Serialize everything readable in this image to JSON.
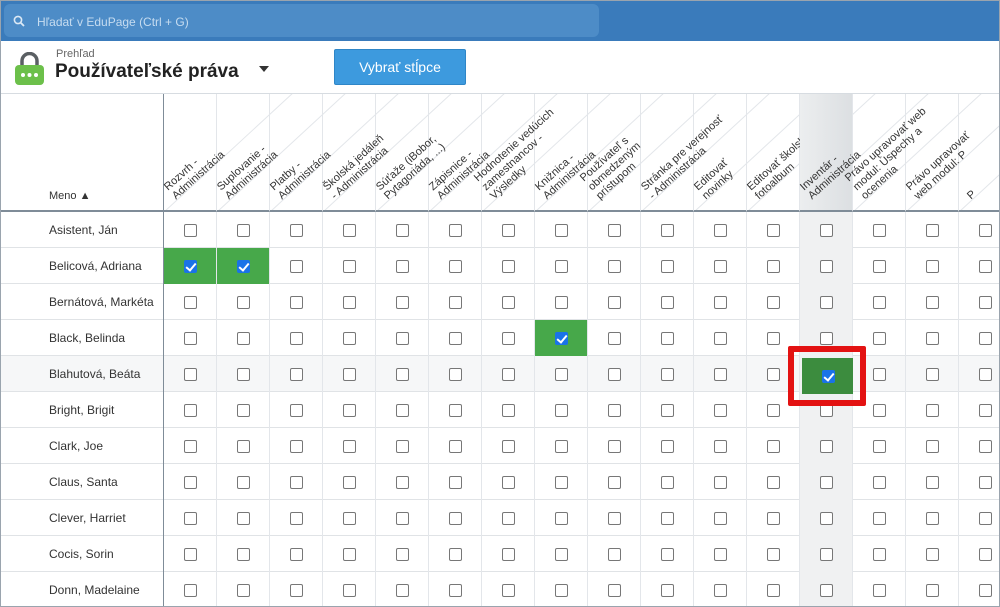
{
  "search": {
    "placeholder": "Hľadať v EduPage (Ctrl + G)"
  },
  "header": {
    "breadcrumb": "Prehľad",
    "title": "Používateľské práva",
    "select_columns_label": "Vybrať stĺpce"
  },
  "table": {
    "name_header": "Meno ▲",
    "columns": [
      "Rozvrh -\nAdministrácia",
      "Suplovanie -\nAdministrácia",
      "Platby -\nAdministrácia",
      "Školská jedáleň\n- Administrácia",
      "Súťaže (iBobor,\nPytagoriáda, ...)",
      "Zápisnice -\nAdministrácia",
      "Hodnotenie vedúcich\nzamestnancov - Výsledky",
      "Knižnica -\nAdministrácia",
      "Používateľ s\nobmedzeným prístupom",
      "Stránka pre verejnosť\n- Administrácia",
      "Editovať\nnovinky",
      "Editovať školský\nfotoalbum",
      "Inventár -\nAdministrácia",
      "Právo upravovať web\nmodul: Úspechy a ocenenia",
      "Právo upravovať\nweb modul: P",
      "P"
    ],
    "rows": [
      {
        "name": "Asistent, Ján",
        "checked": []
      },
      {
        "name": "Belicová, Adriana",
        "checked": [
          0,
          1
        ]
      },
      {
        "name": "Bernátová, Markéta",
        "checked": []
      },
      {
        "name": "Black, Belinda",
        "checked": [
          7
        ]
      },
      {
        "name": "Blahutová, Beáta",
        "checked": [
          12
        ]
      },
      {
        "name": "Bright, Brigit",
        "checked": []
      },
      {
        "name": "Clark, Joe",
        "checked": []
      },
      {
        "name": "Claus, Santa",
        "checked": []
      },
      {
        "name": "Clever, Harriet",
        "checked": []
      },
      {
        "name": "Cocis, Sorin",
        "checked": []
      },
      {
        "name": "Donn, Madelaine",
        "checked": []
      }
    ],
    "highlighted_column": 12,
    "highlighted_row": 4
  },
  "colors": {
    "topbar": "#3a7bbb",
    "check_green": "#47a84a",
    "accent_blue": "#3d9ade",
    "highlight_red": "#e31212"
  }
}
